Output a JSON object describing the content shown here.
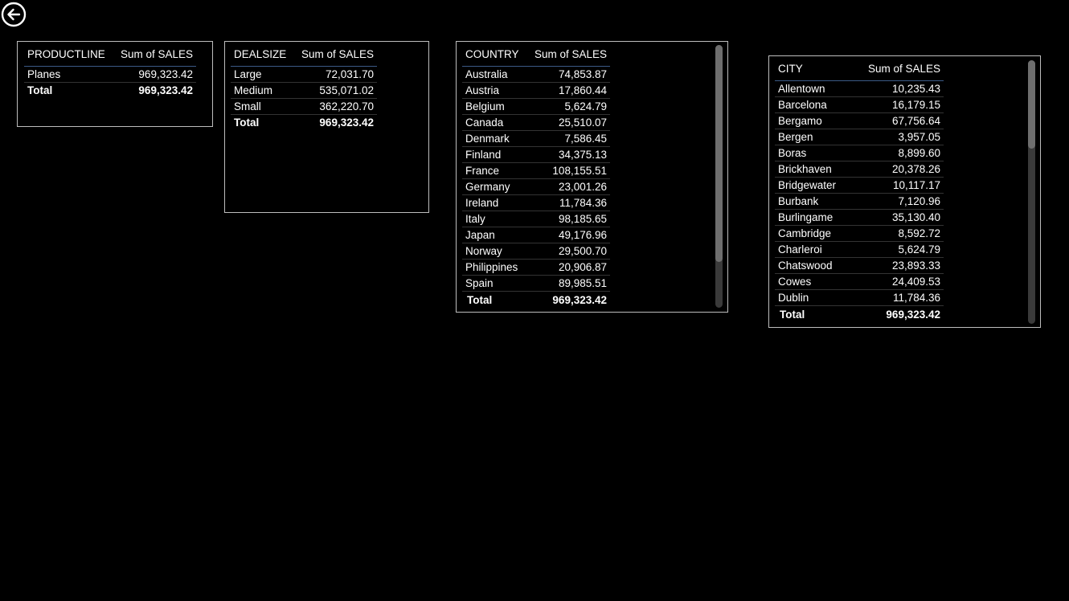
{
  "productline_table": {
    "headers": [
      "PRODUCTLINE",
      "Sum of SALES"
    ],
    "rows": [
      [
        "Planes",
        "969,323.42"
      ]
    ],
    "total": [
      "Total",
      "969,323.42"
    ]
  },
  "dealsize_table": {
    "headers": [
      "DEALSIZE",
      "Sum of SALES"
    ],
    "rows": [
      [
        "Large",
        "72,031.70"
      ],
      [
        "Medium",
        "535,071.02"
      ],
      [
        "Small",
        "362,220.70"
      ]
    ],
    "total": [
      "Total",
      "969,323.42"
    ]
  },
  "country_table": {
    "headers": [
      "COUNTRY",
      "Sum of SALES"
    ],
    "rows": [
      [
        "Australia",
        "74,853.87"
      ],
      [
        "Austria",
        "17,860.44"
      ],
      [
        "Belgium",
        "5,624.79"
      ],
      [
        "Canada",
        "25,510.07"
      ],
      [
        "Denmark",
        "7,586.45"
      ],
      [
        "Finland",
        "34,375.13"
      ],
      [
        "France",
        "108,155.51"
      ],
      [
        "Germany",
        "23,001.26"
      ],
      [
        "Ireland",
        "11,784.36"
      ],
      [
        "Italy",
        "98,185.65"
      ],
      [
        "Japan",
        "49,176.96"
      ],
      [
        "Norway",
        "29,500.70"
      ],
      [
        "Philippines",
        "20,906.87"
      ],
      [
        "Spain",
        "89,985.51"
      ]
    ],
    "total": [
      "Total",
      "969,323.42"
    ]
  },
  "city_table": {
    "headers": [
      "CITY",
      "Sum of SALES"
    ],
    "rows": [
      [
        "Allentown",
        "10,235.43"
      ],
      [
        "Barcelona",
        "16,179.15"
      ],
      [
        "Bergamo",
        "67,756.64"
      ],
      [
        "Bergen",
        "3,957.05"
      ],
      [
        "Boras",
        "8,899.60"
      ],
      [
        "Brickhaven",
        "20,378.26"
      ],
      [
        "Bridgewater",
        "10,117.17"
      ],
      [
        "Burbank",
        "7,120.96"
      ],
      [
        "Burlingame",
        "35,130.40"
      ],
      [
        "Cambridge",
        "8,592.72"
      ],
      [
        "Charleroi",
        "5,624.79"
      ],
      [
        "Chatswood",
        "23,893.33"
      ],
      [
        "Cowes",
        "24,409.53"
      ],
      [
        "Dublin",
        "11,784.36"
      ]
    ],
    "total": [
      "Total",
      "969,323.42"
    ]
  }
}
